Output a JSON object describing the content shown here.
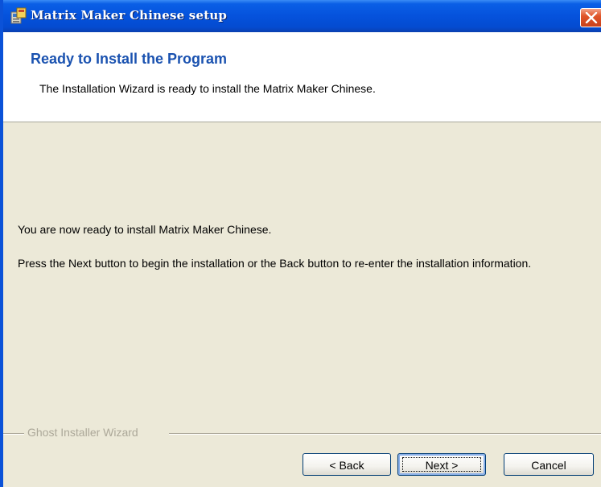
{
  "window": {
    "title": "Matrix Maker Chinese setup"
  },
  "header": {
    "title": "Ready to Install the Program",
    "subtitle": "The Installation Wizard is ready to install the Matrix Maker Chinese."
  },
  "body": {
    "line1": "You are now ready to install Matrix Maker Chinese.",
    "line2": "Press the Next button to begin the installation or the Back button to re-enter the installation information."
  },
  "separator": {
    "label": "Ghost Installer Wizard"
  },
  "buttons": {
    "back": "< Back",
    "next": "Next >",
    "cancel": "Cancel"
  },
  "colors": {
    "titlebar": "#0552dc",
    "header_title": "#1a52b0",
    "dialog_bg": "#ece9d8",
    "close_button": "#e0552a"
  },
  "icons": {
    "app": "installer-icon",
    "close": "close-icon"
  }
}
